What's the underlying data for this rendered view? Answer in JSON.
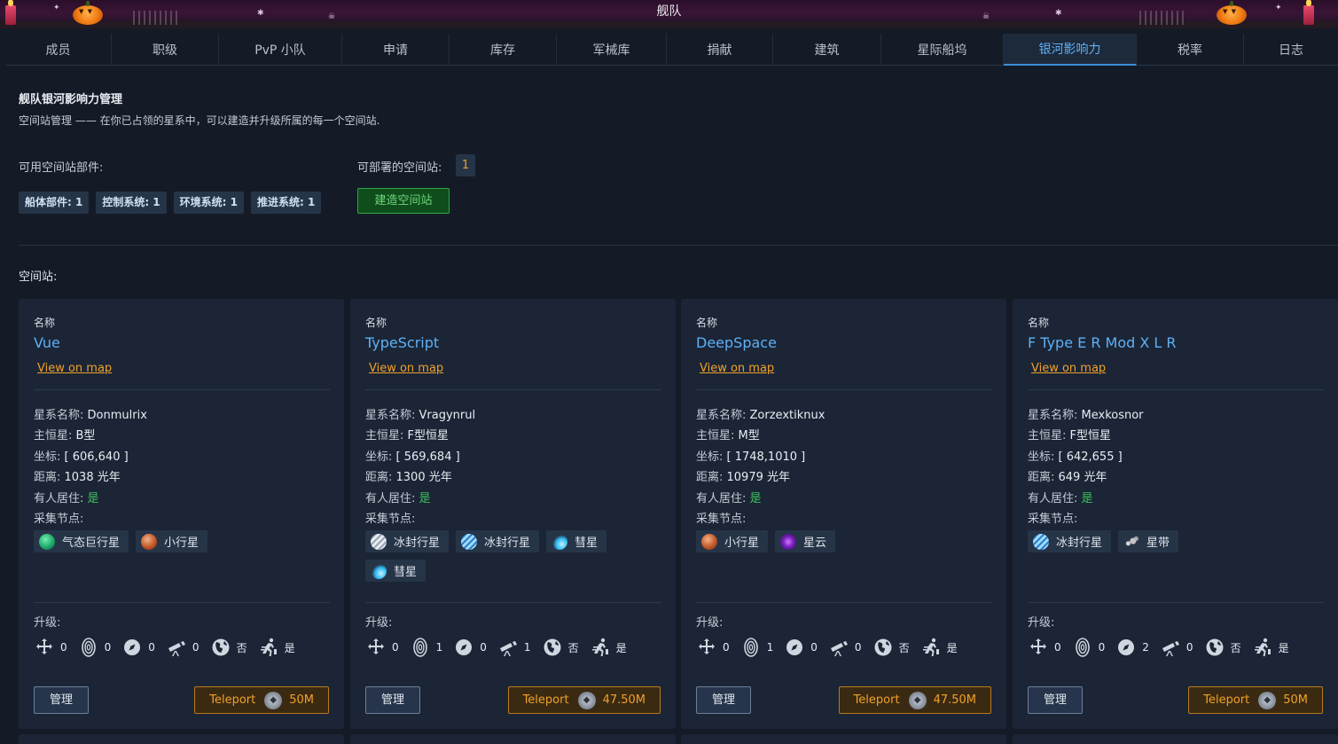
{
  "banner": {
    "title": "舰队"
  },
  "tabs": [
    {
      "label": "成员",
      "active": false
    },
    {
      "label": "职级",
      "active": false
    },
    {
      "label": "PvP 小队",
      "active": false
    },
    {
      "label": "申请",
      "active": false
    },
    {
      "label": "库存",
      "active": false
    },
    {
      "label": "军械库",
      "active": false
    },
    {
      "label": "捐献",
      "active": false
    },
    {
      "label": "建筑",
      "active": false
    },
    {
      "label": "星际船坞",
      "active": false
    },
    {
      "label": "银河影响力",
      "active": true
    },
    {
      "label": "税率",
      "active": false
    },
    {
      "label": "日志",
      "active": false
    }
  ],
  "header": {
    "title": "舰队银河影响力管理",
    "description": "空间站管理 —— 在你已占领的星系中，可以建造并升级所属的每一个空间站.",
    "parts_label": "可用空间站部件:",
    "parts": [
      "船体部件: 1",
      "控制系统: 1",
      "环境系统: 1",
      "推进系统: 1"
    ],
    "deploy_label": "可部署的空间站:",
    "deploy_count": "1",
    "build_button": "建造空间站",
    "stations_label": "空间站:"
  },
  "labels": {
    "name": "名称",
    "view_on_map": "View on map",
    "system": "星系名称:",
    "star": "主恒星:",
    "coords": "坐标:",
    "distance": "距离:",
    "inhabited": "有人居住:",
    "nodes": "采集节点:",
    "upgrades": "升级:",
    "manage": "管理",
    "teleport": "Teleport"
  },
  "colors": {
    "accent_blue": "#5fb0f4",
    "accent_orange": "#f0a12a",
    "yes_green": "#3cc35b"
  },
  "stations": [
    {
      "name": "Vue",
      "system": "Donmulrix",
      "star": "B型",
      "coords": "[ 606,640 ]",
      "distance": "1038 光年",
      "inhabited": "是",
      "nodes": [
        {
          "label": "气态巨行星",
          "icon": "gas-giant-icon"
        },
        {
          "label": "小行星",
          "icon": "asteroid-icon"
        }
      ],
      "upgrades": [
        "0",
        "0",
        "0",
        "0",
        "否",
        "是"
      ],
      "teleport_cost": "50M"
    },
    {
      "name": "TypeScript",
      "system": "Vragynrul",
      "star": "F型恒星",
      "coords": "[ 569,684 ]",
      "distance": "1300 光年",
      "inhabited": "是",
      "nodes": [
        {
          "label": "冰封行星",
          "icon": "ice-planet-grey-icon"
        },
        {
          "label": "冰封行星",
          "icon": "ice-planet-icon"
        },
        {
          "label": "彗星",
          "icon": "comet-icon"
        },
        {
          "label": "彗星",
          "icon": "comet-icon"
        }
      ],
      "upgrades": [
        "0",
        "1",
        "0",
        "1",
        "否",
        "是"
      ],
      "teleport_cost": "47.50M"
    },
    {
      "name": "DeepSpace",
      "system": "Zorzextiknux",
      "star": "M型",
      "coords": "[ 1748,1010 ]",
      "distance": "10979 光年",
      "inhabited": "是",
      "nodes": [
        {
          "label": "小行星",
          "icon": "asteroid-icon"
        },
        {
          "label": "星云",
          "icon": "nebula-icon"
        }
      ],
      "upgrades": [
        "0",
        "1",
        "0",
        "0",
        "否",
        "是"
      ],
      "teleport_cost": "47.50M"
    },
    {
      "name": "F Type E R Mod X L R",
      "system": "Mexkosnor",
      "star": "F型恒星",
      "coords": "[ 642,655 ]",
      "distance": "649 光年",
      "inhabited": "是",
      "nodes": [
        {
          "label": "冰封行星",
          "icon": "ice-planet-icon"
        },
        {
          "label": "星带",
          "icon": "asteroid-belt-icon"
        }
      ],
      "upgrades": [
        "0",
        "0",
        "2",
        "0",
        "否",
        "是"
      ],
      "teleport_cost": "50M"
    }
  ]
}
